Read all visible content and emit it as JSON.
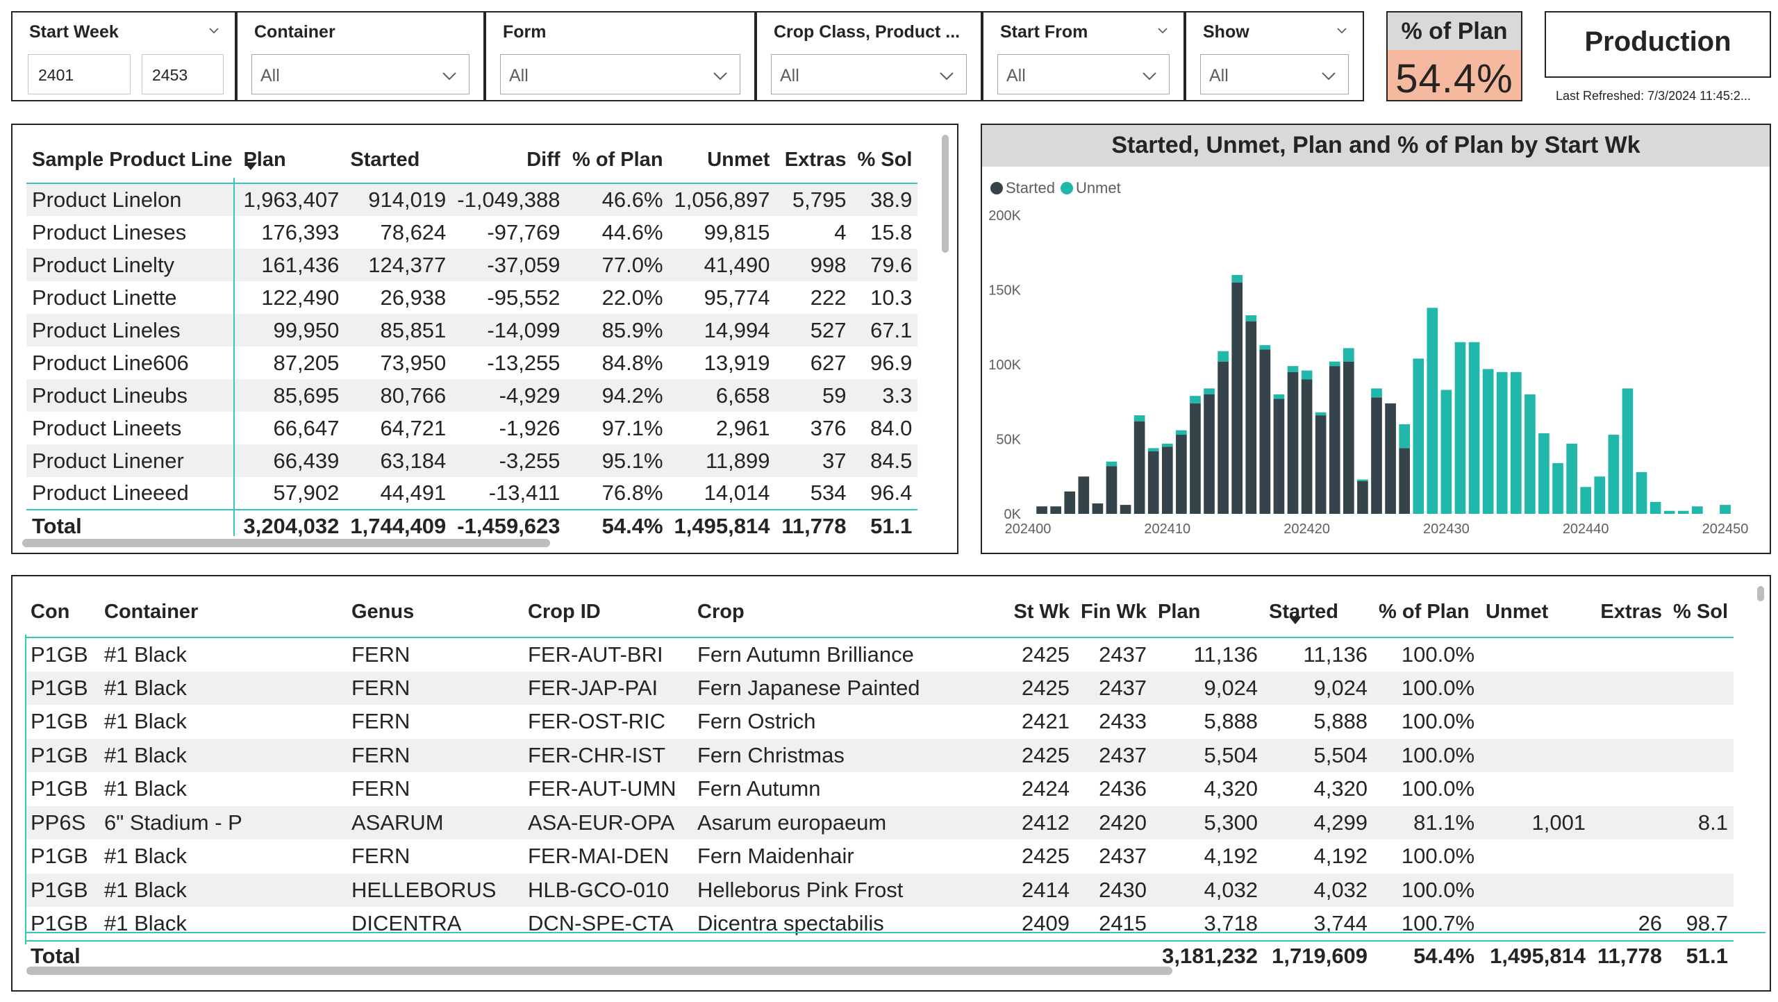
{
  "colors": {
    "accent": "#36c6b8",
    "started": "#35434a",
    "unmet": "#21b7aa",
    "kpi_bg": "#f4b99e",
    "header_gray": "#d9d9d9"
  },
  "slicers": {
    "start_week": {
      "title": "Start Week",
      "from": "2401",
      "to": "2453"
    },
    "container": {
      "title": "Container",
      "value": "All"
    },
    "form": {
      "title": "Form",
      "value": "All"
    },
    "crop_class": {
      "title": "Crop Class, Product ...",
      "value": "All"
    },
    "start_from": {
      "title": "Start From",
      "value": "All"
    },
    "show": {
      "title": "Show",
      "value": "All"
    }
  },
  "kpi": {
    "title": "% of Plan",
    "value": "54.4%"
  },
  "page": {
    "title": "Production",
    "last_refreshed": "Last Refreshed: 7/3/2024 11:45:2..."
  },
  "product_table": {
    "headers": [
      "Sample Product Line",
      "Plan",
      "Started",
      "Diff",
      "% of Plan",
      "Unmet",
      "Extras",
      "% Sol"
    ],
    "rows": [
      [
        "Product Linelon",
        "1,963,407",
        "914,019",
        "-1,049,388",
        "46.6%",
        "1,056,897",
        "5,795",
        "38.9"
      ],
      [
        "Product Lineses",
        "176,393",
        "78,624",
        "-97,769",
        "44.6%",
        "99,815",
        "4",
        "15.8"
      ],
      [
        "Product Linelty",
        "161,436",
        "124,377",
        "-37,059",
        "77.0%",
        "41,490",
        "998",
        "79.6"
      ],
      [
        "Product Linette",
        "122,490",
        "26,938",
        "-95,552",
        "22.0%",
        "95,774",
        "222",
        "10.3"
      ],
      [
        "Product Lineles",
        "99,950",
        "85,851",
        "-14,099",
        "85.9%",
        "14,994",
        "527",
        "67.1"
      ],
      [
        "Product Line606",
        "87,205",
        "73,950",
        "-13,255",
        "84.8%",
        "13,919",
        "627",
        "96.9"
      ],
      [
        "Product Lineubs",
        "85,695",
        "80,766",
        "-4,929",
        "94.2%",
        "6,658",
        "59",
        "3.3"
      ],
      [
        "Product Lineets",
        "66,647",
        "64,721",
        "-1,926",
        "97.1%",
        "2,961",
        "376",
        "84.0"
      ],
      [
        "Product Linener",
        "66,439",
        "63,184",
        "-3,255",
        "95.1%",
        "11,899",
        "37",
        "84.5"
      ],
      [
        "Product Lineeed",
        "57,902",
        "44,491",
        "-13,411",
        "76.8%",
        "14,014",
        "534",
        "96.4"
      ]
    ],
    "total": [
      "Total",
      "3,204,032",
      "1,744,409",
      "-1,459,623",
      "54.4%",
      "1,495,814",
      "11,778",
      "51.1"
    ]
  },
  "chart_data": {
    "type": "bar",
    "stacked": true,
    "title": "Started, Unmet, Plan and % of Plan by Start Wk",
    "legend_position": "top-left",
    "x_tick_labels": [
      "202400",
      "202410",
      "202420",
      "202430",
      "202440",
      "202450"
    ],
    "y_tick_labels": [
      "0K",
      "50K",
      "100K",
      "150K",
      "200K"
    ],
    "ylim": [
      0,
      200000
    ],
    "xlim": [
      202400,
      202450
    ],
    "x": [
      202401,
      202402,
      202403,
      202404,
      202405,
      202406,
      202407,
      202408,
      202409,
      202410,
      202411,
      202412,
      202413,
      202414,
      202415,
      202416,
      202417,
      202418,
      202419,
      202420,
      202421,
      202422,
      202423,
      202424,
      202425,
      202426,
      202427,
      202428,
      202429,
      202430,
      202431,
      202432,
      202433,
      202434,
      202435,
      202436,
      202437,
      202438,
      202439,
      202440,
      202441,
      202442,
      202443,
      202444,
      202445,
      202446,
      202447,
      202448,
      202449,
      202450
    ],
    "series": [
      {
        "name": "Started",
        "values": [
          5000,
          5000,
          15000,
          25000,
          7000,
          32000,
          6000,
          62000,
          42000,
          45000,
          53000,
          74000,
          80000,
          102000,
          155000,
          129000,
          110000,
          77000,
          95000,
          90000,
          66000,
          99000,
          102000,
          22000,
          78000,
          74000,
          44000,
          0,
          0,
          0,
          0,
          0,
          0,
          0,
          0,
          0,
          0,
          0,
          0,
          0,
          0,
          0,
          0,
          0,
          0,
          0,
          0,
          0,
          0,
          0
        ]
      },
      {
        "name": "Unmet",
        "values": [
          0,
          0,
          0,
          0,
          0,
          3000,
          0,
          4000,
          2000,
          2000,
          3000,
          5000,
          4000,
          7000,
          5000,
          4000,
          3000,
          3000,
          4000,
          6000,
          2000,
          3000,
          9000,
          1000,
          6000,
          0,
          16000,
          104000,
          138000,
          83000,
          115000,
          115000,
          97000,
          95000,
          95000,
          80000,
          54000,
          34000,
          47000,
          18000,
          25000,
          53000,
          84000,
          28000,
          8000,
          2000,
          2000,
          5000,
          0,
          6000
        ]
      }
    ]
  },
  "detail_table": {
    "headers": [
      "Con",
      "Container",
      "Genus",
      "Crop ID",
      "Crop",
      "St Wk",
      "Fin Wk",
      "Plan",
      "Started",
      "% of Plan",
      "Unmet",
      "Extras",
      "% Sol"
    ],
    "rows": [
      [
        "P1GB",
        "#1 Black",
        "FERN",
        "FER-AUT-BRI",
        "Fern Autumn Brilliance",
        "2425",
        "2437",
        "11,136",
        "11,136",
        "100.0%",
        "",
        "",
        ""
      ],
      [
        "P1GB",
        "#1 Black",
        "FERN",
        "FER-JAP-PAI",
        "Fern Japanese Painted",
        "2425",
        "2437",
        "9,024",
        "9,024",
        "100.0%",
        "",
        "",
        ""
      ],
      [
        "P1GB",
        "#1 Black",
        "FERN",
        "FER-OST-RIC",
        "Fern Ostrich",
        "2421",
        "2433",
        "5,888",
        "5,888",
        "100.0%",
        "",
        "",
        ""
      ],
      [
        "P1GB",
        "#1 Black",
        "FERN",
        "FER-CHR-IST",
        "Fern Christmas",
        "2425",
        "2437",
        "5,504",
        "5,504",
        "100.0%",
        "",
        "",
        ""
      ],
      [
        "P1GB",
        "#1 Black",
        "FERN",
        "FER-AUT-UMN",
        "Fern Autumn",
        "2424",
        "2436",
        "4,320",
        "4,320",
        "100.0%",
        "",
        "",
        ""
      ],
      [
        "PP6S",
        "6\" Stadium - P",
        "ASARUM",
        "ASA-EUR-OPA",
        "Asarum europaeum",
        "2412",
        "2420",
        "5,300",
        "4,299",
        "81.1%",
        "1,001",
        "",
        "8.1"
      ],
      [
        "P1GB",
        "#1 Black",
        "FERN",
        "FER-MAI-DEN",
        "Fern Maidenhair",
        "2425",
        "2437",
        "4,192",
        "4,192",
        "100.0%",
        "",
        "",
        ""
      ],
      [
        "P1GB",
        "#1 Black",
        "HELLEBORUS",
        "HLB-GCO-010",
        "Helleborus Pink Frost",
        "2414",
        "2430",
        "4,032",
        "4,032",
        "100.0%",
        "",
        "",
        ""
      ],
      [
        "P1GB",
        "#1 Black",
        "DICENTRA",
        "DCN-SPE-CTA",
        "Dicentra spectabilis",
        "2409",
        "2415",
        "3,718",
        "3,744",
        "100.7%",
        "",
        "26",
        "98.7"
      ]
    ],
    "total": [
      "Total",
      "",
      "",
      "",
      "",
      "",
      "",
      "3,181,232",
      "1,719,609",
      "54.4%",
      "1,495,814",
      "11,778",
      "51.1"
    ]
  }
}
